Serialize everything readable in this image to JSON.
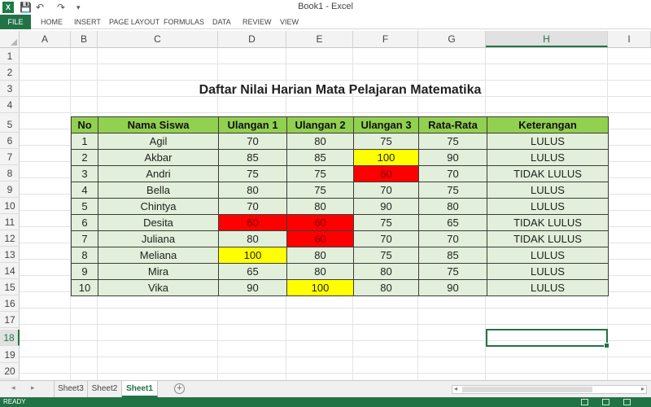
{
  "window": {
    "title": "Book1 - Excel",
    "app_icon": "X"
  },
  "quick_access": {
    "save_icon": "💾",
    "undo_icon": "↶",
    "redo_icon": "↷",
    "more_icon": "▾"
  },
  "ribbon": {
    "file": "FILE",
    "tabs": [
      "HOME",
      "INSERT",
      "PAGE LAYOUT",
      "FORMULAS",
      "DATA",
      "REVIEW",
      "VIEW"
    ]
  },
  "columns": [
    "A",
    "B",
    "C",
    "D",
    "E",
    "F",
    "G",
    "H",
    "I"
  ],
  "active_column": "H",
  "rows": [
    "1",
    "2",
    "3",
    "4",
    "5",
    "6",
    "7",
    "8",
    "9",
    "10",
    "11",
    "12",
    "13",
    "14",
    "15",
    "16",
    "17",
    "18",
    "19",
    "20"
  ],
  "active_row": "18",
  "sheet_title": "Daftar Nilai Harian Mata Pelajaran Matematika",
  "table": {
    "headers": [
      "No",
      "Nama Siswa",
      "Ulangan 1",
      "Ulangan 2",
      "Ulangan 3",
      "Rata-Rata",
      "Keterangan"
    ],
    "rows": [
      {
        "cells": [
          "1",
          "Agil",
          "70",
          "80",
          "75",
          "75",
          "LULUS"
        ],
        "fills": [
          "",
          "",
          "",
          "",
          "",
          "",
          ""
        ]
      },
      {
        "cells": [
          "2",
          "Akbar",
          "85",
          "85",
          "100",
          "90",
          "LULUS"
        ],
        "fills": [
          "",
          "",
          "",
          "",
          "yellow",
          "",
          ""
        ]
      },
      {
        "cells": [
          "3",
          "Andri",
          "75",
          "75",
          "60",
          "70",
          "TIDAK LULUS"
        ],
        "fills": [
          "",
          "",
          "",
          "",
          "red",
          "",
          ""
        ]
      },
      {
        "cells": [
          "4",
          "Bella",
          "80",
          "75",
          "70",
          "75",
          "LULUS"
        ],
        "fills": [
          "",
          "",
          "",
          "",
          "",
          "",
          ""
        ]
      },
      {
        "cells": [
          "5",
          "Chintya",
          "70",
          "80",
          "90",
          "80",
          "LULUS"
        ],
        "fills": [
          "",
          "",
          "",
          "",
          "",
          "",
          ""
        ]
      },
      {
        "cells": [
          "6",
          "Desita",
          "60",
          "60",
          "75",
          "65",
          "TIDAK LULUS"
        ],
        "fills": [
          "",
          "",
          "red",
          "red",
          "",
          "",
          ""
        ]
      },
      {
        "cells": [
          "7",
          "Juliana",
          "80",
          "60",
          "70",
          "70",
          "TIDAK LULUS"
        ],
        "fills": [
          "",
          "",
          "",
          "red",
          "",
          "",
          ""
        ]
      },
      {
        "cells": [
          "8",
          "Meliana",
          "100",
          "80",
          "75",
          "85",
          "LULUS"
        ],
        "fills": [
          "",
          "",
          "yellow",
          "",
          "",
          "",
          ""
        ]
      },
      {
        "cells": [
          "9",
          "Mira",
          "65",
          "80",
          "80",
          "75",
          "LULUS"
        ],
        "fills": [
          "",
          "",
          "",
          "",
          "",
          "",
          ""
        ]
      },
      {
        "cells": [
          "10",
          "Vika",
          "90",
          "100",
          "80",
          "90",
          "LULUS"
        ],
        "fills": [
          "",
          "",
          "",
          "yellow",
          "",
          "",
          ""
        ]
      }
    ]
  },
  "colors": {
    "header_fill": "#92d050",
    "body_fill": "#e2efda",
    "low_score": "#ff0000",
    "high_score": "#ffff00",
    "excel_green": "#217346"
  },
  "sheet_tabs": [
    "Sheet3",
    "Sheet2",
    "Sheet1"
  ],
  "active_sheet": "Sheet1",
  "add_sheet_icon": "+",
  "status": {
    "text": "READY"
  }
}
